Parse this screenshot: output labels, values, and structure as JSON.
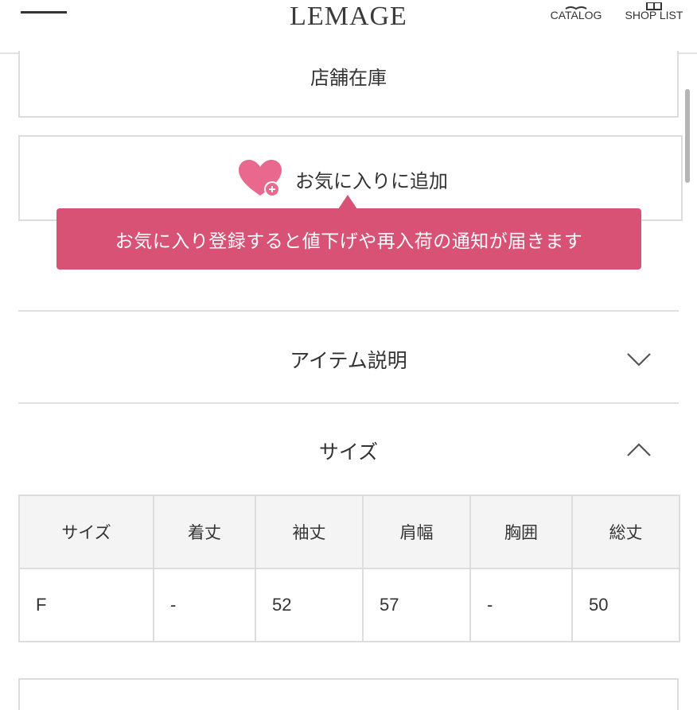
{
  "header": {
    "logo": "LEMAGE",
    "catalog_label": "CATALOG",
    "shop_list_label": "SHOP LIST"
  },
  "store_stock": {
    "label": "店舗在庫"
  },
  "favorite": {
    "label": "お気に入りに追加",
    "icon": "heart-plus-icon",
    "tooltip": "お気に入り登録すると値下げや再入荷の通知が届きます"
  },
  "accordions": [
    {
      "label": "アイテム説明",
      "state": "collapsed",
      "icon": "chevron-down-icon"
    },
    {
      "label": "サイズ",
      "state": "expanded",
      "icon": "chevron-up-icon"
    }
  ],
  "size_table": {
    "headers": [
      "サイズ",
      "着丈",
      "袖丈",
      "肩幅",
      "胸囲",
      "総丈"
    ],
    "rows": [
      [
        "F",
        "-",
        "52",
        "57",
        "-",
        "50"
      ]
    ]
  },
  "colors": {
    "accent": "#d85275",
    "heart": "#e8688e",
    "border": "#dcdcdc"
  }
}
